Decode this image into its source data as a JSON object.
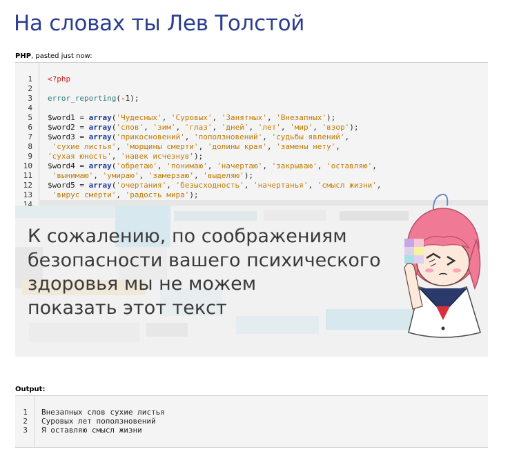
{
  "page": {
    "title": "На словах ты Лев Толстой"
  },
  "paste": {
    "language": "PHP",
    "meta": ", pasted just now:"
  },
  "code": {
    "lines": [
      {
        "n": "1",
        "tokens": [
          {
            "t": "tag",
            "v": "<?php"
          }
        ]
      },
      {
        "n": "2",
        "tokens": []
      },
      {
        "n": "3",
        "tokens": [
          {
            "t": "fn",
            "v": "error_reporting"
          },
          {
            "t": "plain",
            "v": "(-1);"
          }
        ]
      },
      {
        "n": "4",
        "tokens": []
      },
      {
        "n": "5",
        "tokens": [
          {
            "t": "plain",
            "v": "$word1 = "
          },
          {
            "t": "kw",
            "v": "array"
          },
          {
            "t": "plain",
            "v": "("
          },
          {
            "t": "str",
            "v": "'Чудесных'"
          },
          {
            "t": "plain",
            "v": ", "
          },
          {
            "t": "str",
            "v": "'Суровых'"
          },
          {
            "t": "plain",
            "v": ", "
          },
          {
            "t": "str",
            "v": "'Занятных'"
          },
          {
            "t": "plain",
            "v": ", "
          },
          {
            "t": "str",
            "v": "'Внезапных'"
          },
          {
            "t": "plain",
            "v": ");"
          }
        ]
      },
      {
        "n": "6",
        "tokens": [
          {
            "t": "plain",
            "v": "$word2 = "
          },
          {
            "t": "kw",
            "v": "array"
          },
          {
            "t": "plain",
            "v": "("
          },
          {
            "t": "str",
            "v": "'слов'"
          },
          {
            "t": "plain",
            "v": ", "
          },
          {
            "t": "str",
            "v": "'зим'"
          },
          {
            "t": "plain",
            "v": ", "
          },
          {
            "t": "str",
            "v": "'глаз'"
          },
          {
            "t": "plain",
            "v": ", "
          },
          {
            "t": "str",
            "v": "'дней'"
          },
          {
            "t": "plain",
            "v": ", "
          },
          {
            "t": "str",
            "v": "'лет'"
          },
          {
            "t": "plain",
            "v": ", "
          },
          {
            "t": "str",
            "v": "'мир'"
          },
          {
            "t": "plain",
            "v": ", "
          },
          {
            "t": "str",
            "v": "'взор'"
          },
          {
            "t": "plain",
            "v": ");"
          }
        ]
      },
      {
        "n": "7",
        "tokens": [
          {
            "t": "plain",
            "v": "$word3 = "
          },
          {
            "t": "kw",
            "v": "array"
          },
          {
            "t": "plain",
            "v": "("
          },
          {
            "t": "str",
            "v": "'прикосновений'"
          },
          {
            "t": "plain",
            "v": ", "
          },
          {
            "t": "str",
            "v": "'поползновений'"
          },
          {
            "t": "plain",
            "v": ", "
          },
          {
            "t": "str",
            "v": "'судьбы явлений'"
          },
          {
            "t": "plain",
            "v": ","
          }
        ]
      },
      {
        "n": "8",
        "tokens": [
          {
            "t": "plain",
            "v": " "
          },
          {
            "t": "str",
            "v": "'сухие листья'"
          },
          {
            "t": "plain",
            "v": ", "
          },
          {
            "t": "str",
            "v": "'морщины смерти'"
          },
          {
            "t": "plain",
            "v": ", "
          },
          {
            "t": "str",
            "v": "'долины края'"
          },
          {
            "t": "plain",
            "v": ", "
          },
          {
            "t": "str",
            "v": "'замены нету'"
          },
          {
            "t": "plain",
            "v": ","
          }
        ]
      },
      {
        "n": "9",
        "tokens": [
          {
            "t": "str",
            "v": "'сухая юность'"
          },
          {
            "t": "plain",
            "v": ", "
          },
          {
            "t": "str",
            "v": "'навек исчезнув'"
          },
          {
            "t": "plain",
            "v": ");"
          }
        ]
      },
      {
        "n": "10",
        "tokens": [
          {
            "t": "plain",
            "v": "$word4 = "
          },
          {
            "t": "kw",
            "v": "array"
          },
          {
            "t": "plain",
            "v": "("
          },
          {
            "t": "str",
            "v": "'обретаю'"
          },
          {
            "t": "plain",
            "v": ", "
          },
          {
            "t": "str",
            "v": "'понимаю'"
          },
          {
            "t": "plain",
            "v": ", "
          },
          {
            "t": "str",
            "v": "'начертаю'"
          },
          {
            "t": "plain",
            "v": ", "
          },
          {
            "t": "str",
            "v": "'закрываю'"
          },
          {
            "t": "plain",
            "v": ", "
          },
          {
            "t": "str",
            "v": "'оставляю'"
          },
          {
            "t": "plain",
            "v": ","
          }
        ]
      },
      {
        "n": "11",
        "tokens": [
          {
            "t": "plain",
            "v": " "
          },
          {
            "t": "str",
            "v": "'вынимаю'"
          },
          {
            "t": "plain",
            "v": ", "
          },
          {
            "t": "str",
            "v": "'умираю'"
          },
          {
            "t": "plain",
            "v": ", "
          },
          {
            "t": "str",
            "v": "'замерзаю'"
          },
          {
            "t": "plain",
            "v": ", "
          },
          {
            "t": "str",
            "v": "'выделяю'"
          },
          {
            "t": "plain",
            "v": ");"
          }
        ]
      },
      {
        "n": "12",
        "tokens": [
          {
            "t": "plain",
            "v": "$word5 = "
          },
          {
            "t": "kw",
            "v": "array"
          },
          {
            "t": "plain",
            "v": "("
          },
          {
            "t": "str",
            "v": "'очертания'"
          },
          {
            "t": "plain",
            "v": ", "
          },
          {
            "t": "str",
            "v": "'безысходность'"
          },
          {
            "t": "plain",
            "v": ", "
          },
          {
            "t": "str",
            "v": "'начертанья'"
          },
          {
            "t": "plain",
            "v": ", "
          },
          {
            "t": "str",
            "v": "'смысл жизни'"
          },
          {
            "t": "plain",
            "v": ","
          }
        ]
      },
      {
        "n": "13",
        "tokens": [
          {
            "t": "plain",
            "v": " "
          },
          {
            "t": "str",
            "v": "'вирус смерти'"
          },
          {
            "t": "plain",
            "v": ", "
          },
          {
            "t": "str",
            "v": "'радость мира'"
          },
          {
            "t": "plain",
            "v": ");"
          }
        ]
      },
      {
        "n": "14",
        "tokens": []
      }
    ]
  },
  "censor": {
    "message_lines": [
      "К сожалению, по соображениям",
      "безопасности вашего психического",
      "здоровья мы не можем",
      "показать этот текст"
    ]
  },
  "output": {
    "label": "Output:",
    "lines": [
      {
        "n": "1",
        "text": "Внезапных слов сухие листья"
      },
      {
        "n": "2",
        "text": "Суровых лет поползновений"
      },
      {
        "n": "3",
        "text": "Я оставляю смысл жизни"
      }
    ]
  },
  "colors": {
    "title": "#2b3e8f",
    "tag": "#cc2222",
    "function": "#2a7a7a",
    "keyword": "#1a3a9a",
    "string": "#c07a00",
    "panel_bg": "#f4f4f4"
  }
}
